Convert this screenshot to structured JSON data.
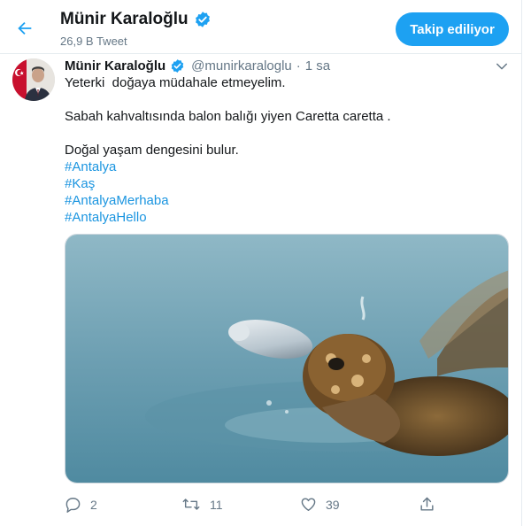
{
  "header": {
    "name": "Münir Karaloğlu",
    "tweet_count": "26,9 B Tweet",
    "follow_label": "Takip ediliyor"
  },
  "tweet": {
    "author": "Münir Karaloğlu",
    "handle": "@munirkaraloglu",
    "separator": "·",
    "time": "1 sa",
    "lines": [
      "Yeterki  doğaya müdahale etmeyelim.",
      "Sabah kahvaltısında balon balığı yiyen Caretta caretta .",
      "Doğal yaşam dengesini bulur."
    ],
    "hashtags": [
      "#Antalya",
      "#Kaş",
      "#AntalyaMerhaba",
      "#AntalyaHello"
    ],
    "actions": {
      "replies": "2",
      "retweets": "11",
      "likes": "39"
    }
  },
  "colors": {
    "accent": "#1da1f2",
    "link": "#1b95e0",
    "secondary_text": "#657786",
    "verified": "#1da1f2"
  },
  "icons": [
    "back-arrow-icon",
    "verified-badge-icon",
    "chevron-down-icon",
    "reply-icon",
    "retweet-icon",
    "like-icon",
    "share-icon"
  ]
}
